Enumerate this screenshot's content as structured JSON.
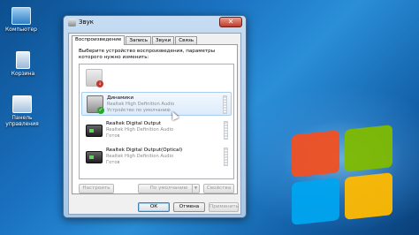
{
  "desktop": {
    "icons": [
      {
        "label": "Компьютер",
        "icon": "computer-icon"
      },
      {
        "label": "Корзина",
        "icon": "recycle-bin-icon"
      },
      {
        "label": "Панель управления",
        "icon": "control-panel-icon"
      }
    ]
  },
  "window": {
    "title": "Звук",
    "close_glyph": "✕",
    "tabs": [
      {
        "label": "Воспроизведение",
        "active": true
      },
      {
        "label": "Запись",
        "active": false
      },
      {
        "label": "Звуки",
        "active": false
      },
      {
        "label": "Связь",
        "active": false
      }
    ],
    "instruction": "Выберите устройство воспроизведения, параметры которого нужно изменить:",
    "devices": [
      {
        "name": "",
        "description": "",
        "status": "",
        "icon": "speaker-icon",
        "badge": "down-arrow"
      },
      {
        "name": "Динамики",
        "description": "Realtek High Definition Audio",
        "status": "Устройство по умолчанию",
        "icon": "speaker-icon",
        "badge": "check",
        "selected": true
      },
      {
        "name": "Realtek Digital Output",
        "description": "Realtek High Definition Audio",
        "status": "Готов",
        "icon": "digital-output-icon"
      },
      {
        "name": "Realtek Digital Output(Optical)",
        "description": "Realtek High Definition Audio",
        "status": "Готов",
        "icon": "digital-output-icon"
      }
    ],
    "buttons": {
      "configure": "Настроить",
      "set_default": "По умолчанию",
      "set_default_arrow": "▼",
      "properties": "Свойства",
      "ok": "ОК",
      "cancel": "Отмена",
      "apply": "Применить"
    }
  }
}
